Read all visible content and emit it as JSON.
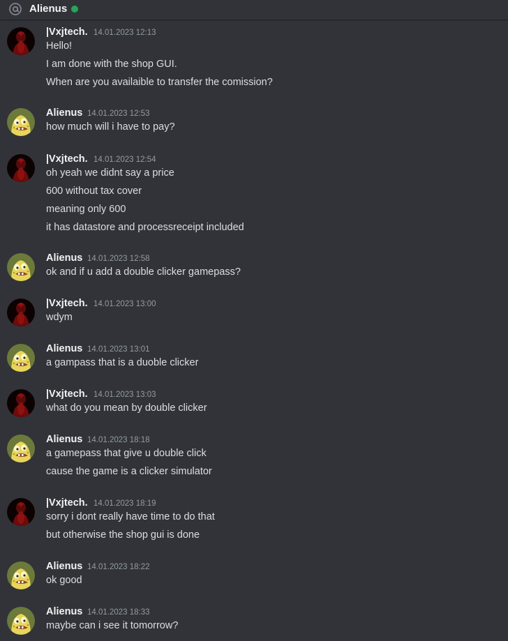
{
  "header": {
    "title": "Alienus",
    "icon": "at-sign-icon",
    "status": "online",
    "status_color": "#23a55a"
  },
  "colors": {
    "background": "#313338",
    "author": "#f2f3f5",
    "timestamp": "#949ba4",
    "message_text": "#dbdee1"
  },
  "messages": [
    {
      "author": "|Vxjtech.",
      "avatar": "dark-red-figure-avatar",
      "timestamp": "14.01.2023 12:13",
      "lines": [
        "Hello!",
        "I am done with the shop GUI.",
        "When are you availaible to transfer the comission?"
      ]
    },
    {
      "author": "Alienus",
      "avatar": "caveman-spongebob-avatar",
      "timestamp": "14.01.2023 12:53",
      "lines": [
        "how much will i have to pay?"
      ]
    },
    {
      "author": "|Vxjtech.",
      "avatar": "dark-red-figure-avatar",
      "timestamp": "14.01.2023 12:54",
      "lines": [
        "oh yeah we didnt say a price",
        "600 without tax cover",
        "meaning only 600",
        "it has datastore and processreceipt included"
      ]
    },
    {
      "author": "Alienus",
      "avatar": "caveman-spongebob-avatar",
      "timestamp": "14.01.2023 12:58",
      "lines": [
        "ok and if u add a double clicker gamepass?"
      ]
    },
    {
      "author": "|Vxjtech.",
      "avatar": "dark-red-figure-avatar",
      "timestamp": "14.01.2023 13:00",
      "lines": [
        "wdym"
      ]
    },
    {
      "author": "Alienus",
      "avatar": "caveman-spongebob-avatar",
      "timestamp": "14.01.2023 13:01",
      "lines": [
        "a gampass that is a duoble clicker"
      ]
    },
    {
      "author": "|Vxjtech.",
      "avatar": "dark-red-figure-avatar",
      "timestamp": "14.01.2023 13:03",
      "lines": [
        "what do you mean by double clicker"
      ]
    },
    {
      "author": "Alienus",
      "avatar": "caveman-spongebob-avatar",
      "timestamp": "14.01.2023 18:18",
      "lines": [
        "a gamepass that give u double click",
        "cause the game is a clicker simulator"
      ]
    },
    {
      "author": "|Vxjtech.",
      "avatar": "dark-red-figure-avatar",
      "timestamp": "14.01.2023 18:19",
      "lines": [
        "sorry i dont really have time to do that",
        "but otherwise the shop gui is done"
      ]
    },
    {
      "author": "Alienus",
      "avatar": "caveman-spongebob-avatar",
      "timestamp": "14.01.2023 18:22",
      "lines": [
        "ok good"
      ]
    },
    {
      "author": "Alienus",
      "avatar": "caveman-spongebob-avatar",
      "timestamp": "14.01.2023 18:33",
      "lines": [
        "maybe can i see it tomorrow?"
      ]
    }
  ]
}
